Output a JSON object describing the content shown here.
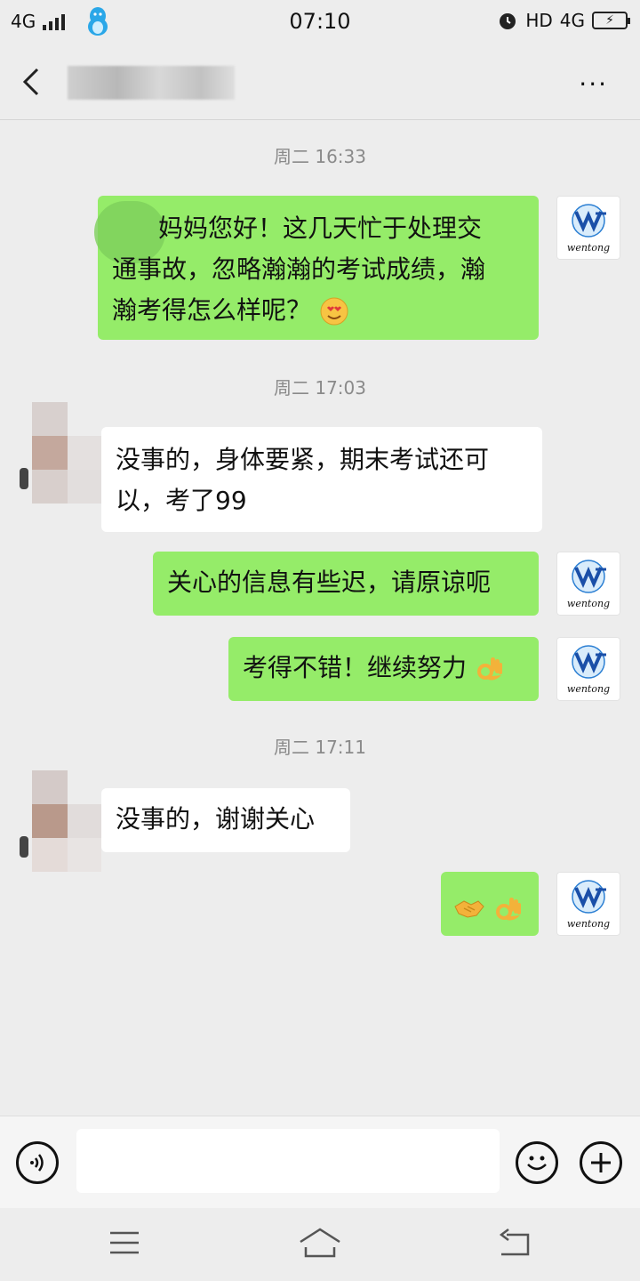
{
  "status_bar": {
    "network_left": "4G",
    "time": "07:10",
    "hd": "HD",
    "network_right": "4G"
  },
  "navbar": {
    "title_blurred": true,
    "more_label": "···"
  },
  "messages": [
    {
      "type": "time",
      "text": "周二 16:33"
    },
    {
      "type": "sent",
      "lines": [
        "妈妈您好！这几天忙于处理交",
        "通事故，忽略瀚瀚的考试成绩，瀚",
        "瀚考得怎么样呢？"
      ],
      "emoji": "smiling-face-heart-eyes"
    },
    {
      "type": "time",
      "text": "周二 17:03"
    },
    {
      "type": "received",
      "lines": [
        "没事的，身体要紧，期末考试还可",
        "以，考了99"
      ]
    },
    {
      "type": "sent",
      "lines": [
        "关心的信息有些迟，请原谅呃"
      ]
    },
    {
      "type": "sent",
      "lines": [
        "考得不错！继续努力"
      ],
      "emoji": "ok-hand"
    },
    {
      "type": "time",
      "text": "周二 17:11"
    },
    {
      "type": "received",
      "lines": [
        "没事的，谢谢关心"
      ]
    },
    {
      "type": "sent",
      "lines": [],
      "emoji": "handshake ok-hand"
    }
  ],
  "avatar_me_text": "wentong",
  "colors": {
    "sent_bubble": "#95ec69",
    "received_bubble": "#ffffff",
    "background": "#ededed"
  }
}
